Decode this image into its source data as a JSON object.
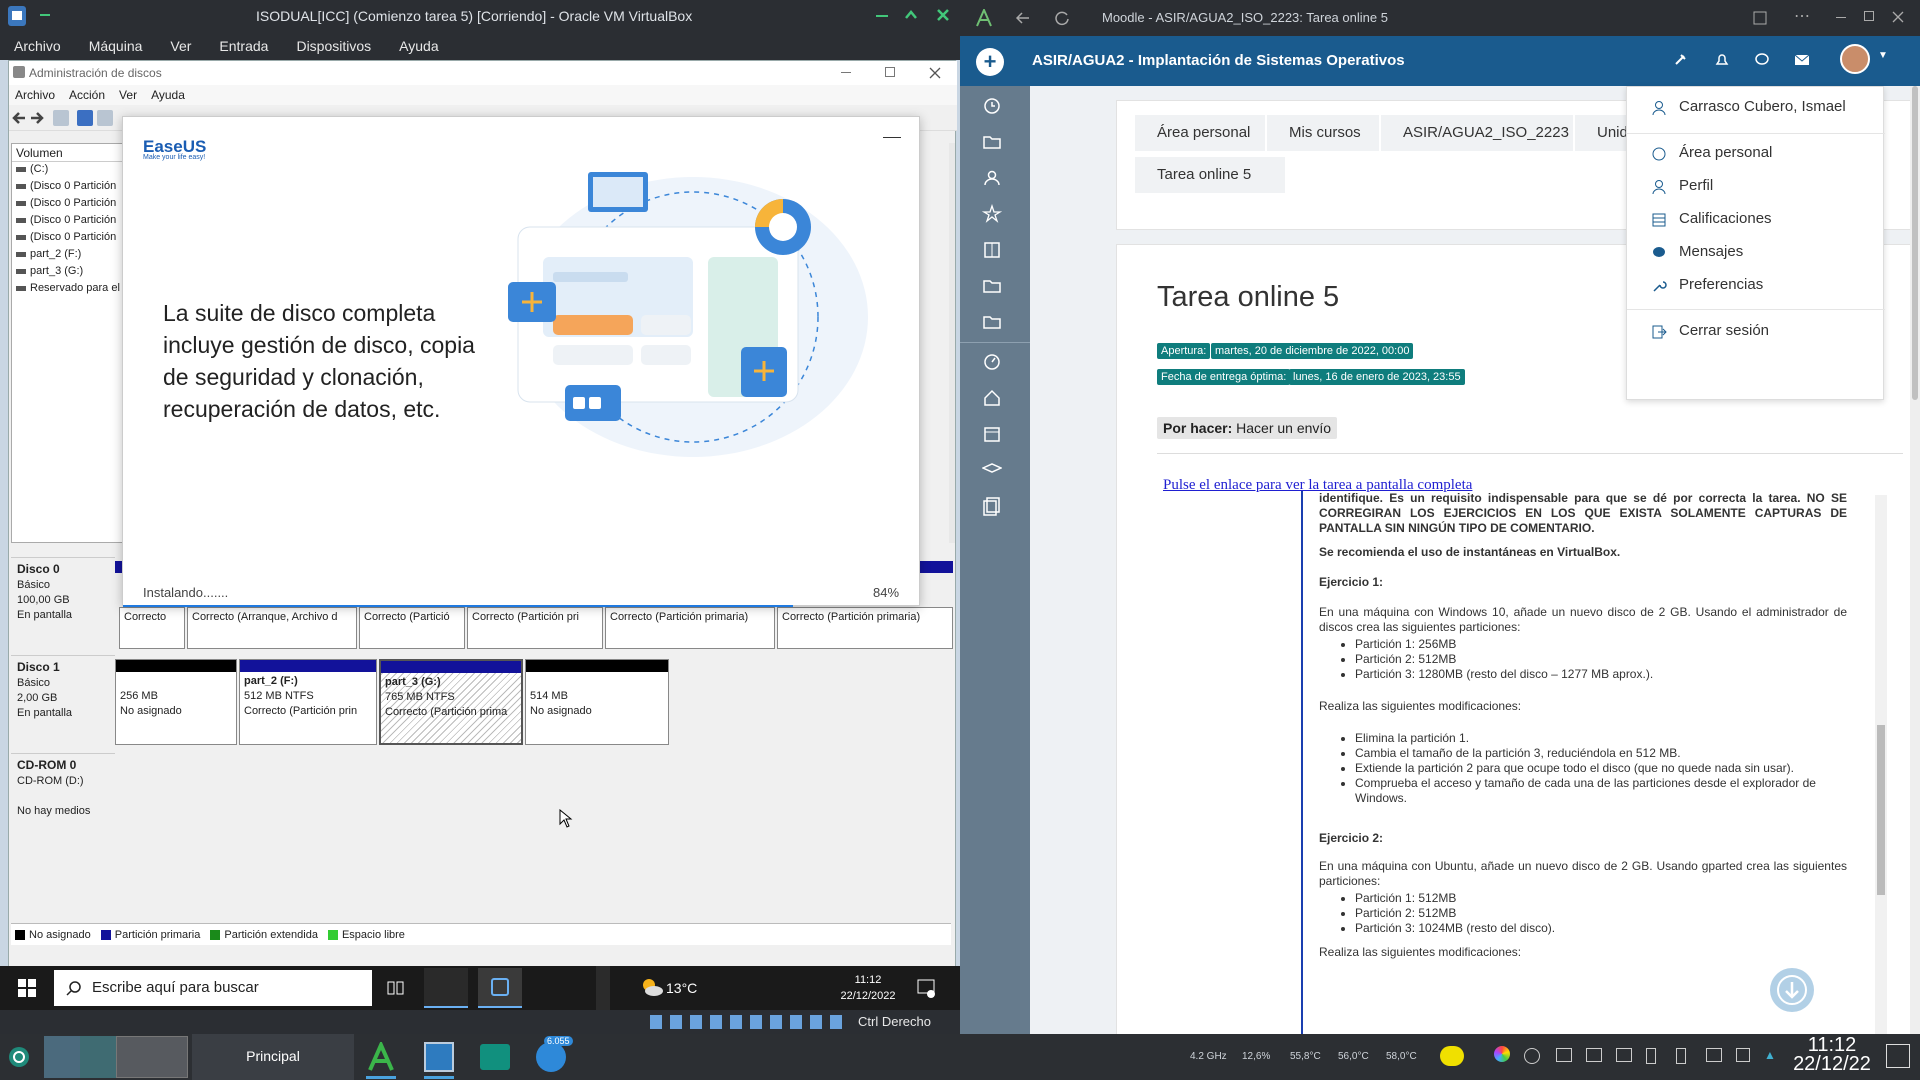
{
  "vbox": {
    "title": "ISODUAL[ICC] (Comienzo tarea 5) [Corriendo] - Oracle VM VirtualBox",
    "menu": [
      "Archivo",
      "Máquina",
      "Ver",
      "Entrada",
      "Dispositivos",
      "Ayuda"
    ],
    "status_host_key": "Ctrl Derecho"
  },
  "diskmgmt": {
    "title": "Administración de discos",
    "menu": [
      "Archivo",
      "Acción",
      "Ver",
      "Ayuda"
    ],
    "volume_header": "Volumen",
    "volumes": [
      "(C:)",
      "(Disco 0 Partición",
      "(Disco 0 Partición",
      "(Disco 0 Partición",
      "(Disco 0 Partición",
      "part_2 (F:)",
      "part_3 (G:)",
      "Reservado para el"
    ],
    "disk0": {
      "name": "Disco 0",
      "type": "Básico",
      "size": "100,00 GB",
      "state": "En pantalla",
      "parts": [
        "Correcto",
        "Correcto (Arranque, Archivo d",
        "Correcto (Partició",
        "Correcto (Partición pri",
        "Correcto (Partición primaria)",
        "Correcto (Partición primaria)"
      ]
    },
    "disk1": {
      "name": "Disco 1",
      "type": "Básico",
      "size": "2,00 GB",
      "state": "En pantalla",
      "parts": [
        {
          "label": "",
          "size": "256 MB",
          "status": "No asignado"
        },
        {
          "label": "part_2 (F:)",
          "size": "512 MB NTFS",
          "status": "Correcto (Partición prin"
        },
        {
          "label": "part_3 (G:)",
          "size": "765 MB NTFS",
          "status": "Correcto (Partición prima"
        },
        {
          "label": "",
          "size": "514 MB",
          "status": "No asignado"
        }
      ]
    },
    "cdrom": {
      "name": "CD-ROM 0",
      "drive": "CD-ROM (D:)",
      "state": "No hay medios"
    },
    "legend": [
      "No asignado",
      "Partición primaria",
      "Partición extendida",
      "Espacio libre"
    ],
    "colors": {
      "unalloc": "#000000",
      "primary": "#12129a",
      "extended": "#1a8a1a",
      "free": "#33cc33"
    }
  },
  "easeus": {
    "brand": "EaseUS",
    "tagline": "Make your life easy!",
    "headline": "La suite de disco completa incluye gestión de disco, copia de seguridad y clonación, recuperación de datos, etc.",
    "status": "Instalando.......",
    "percent": "84%",
    "progress": 0.84
  },
  "guest_taskbar": {
    "search_placeholder": "Escribe aquí para buscar",
    "temp": "13°C",
    "time": "11:12",
    "date": "22/12/2022"
  },
  "browser": {
    "title": "Moodle - ASIR/AGUA2_ISO_2223: Tarea online 5",
    "course": "ASIR/AGUA2 - Implantación de Sistemas Operativos",
    "breadcrumbs": [
      "Área personal",
      "Mis cursos",
      "ASIR/AGUA2_ISO_2223",
      "Unidad de",
      "Tarea online 5"
    ],
    "page_title": "Tarea online 5",
    "apertura_label": "Apertura:",
    "apertura_value": "martes, 20 de diciembre de 2022, 00:00",
    "entrega_label": "Fecha de entrega óptima:",
    "entrega_value": "lunes, 16 de enero de 2023, 23:55",
    "porhacer_label": "Por hacer:",
    "porhacer_value": "Hacer un envío",
    "link": "Pulse el enlace para ver la tarea a pantalla completa",
    "frame": {
      "p1": "identifique.  Es un requisito indispensable para que se dé por correcta la tarea. NO SE CORREGIRAN LOS EJERCICIOS EN LOS QUE EXISTA SOLAMENTE CAPTURAS DE PANTALLA SIN NINGÚN TIPO DE COMENTARIO.",
      "p2": "Se recomienda el uso de instantáneas en VirtualBox.",
      "ej1": "Ejercicio 1:",
      "ej1_intro": "En una máquina con Windows 10, añade un nuevo disco de 2 GB.  Usando el administrador de discos crea las siguientes particiones:",
      "ej1_parts": [
        "Partición 1: 256MB",
        "Partición 2: 512MB",
        "Partición 3: 1280MB (resto del disco – 1277 MB aprox.)."
      ],
      "ej1_mods_intro": "Realiza las siguientes modificaciones:",
      "ej1_mods": [
        "Elimina la partición 1.",
        "Cambia el tamaño de la partición 3, reduciéndola en 512 MB.",
        "Extiende la partición 2 para que ocupe todo el disco (que no quede nada sin usar).",
        "Comprueba el acceso y tamaño de cada una de las particiones desde el explorador de Windows."
      ],
      "ej2": "Ejercicio 2:",
      "ej2_intro": "En una máquina con Ubuntu, añade un nuevo disco de 2 GB.  Usando gparted crea las siguientes particiones:",
      "ej2_parts": [
        "Partición 1: 512MB",
        "Partición 2: 512MB",
        "Partición 3: 1024MB (resto del disco)."
      ],
      "ej2_mods_intro": "Realiza las siguientes modificaciones:"
    },
    "user_menu": [
      "Carrasco Cubero, Ismael",
      "Área personal",
      "Perfil",
      "Calificaciones",
      "Mensajes",
      "Preferencias",
      "Cerrar sesión"
    ]
  },
  "host_taskbar": {
    "workspace": "Principal",
    "badge": "6.055",
    "cpu_freq": "4.2 GHz",
    "cpu_load": "12,6%",
    "temps": [
      "55,8°C",
      "56,0°C",
      "58,0°C"
    ],
    "time": "11:12",
    "date": "22/12/22"
  }
}
